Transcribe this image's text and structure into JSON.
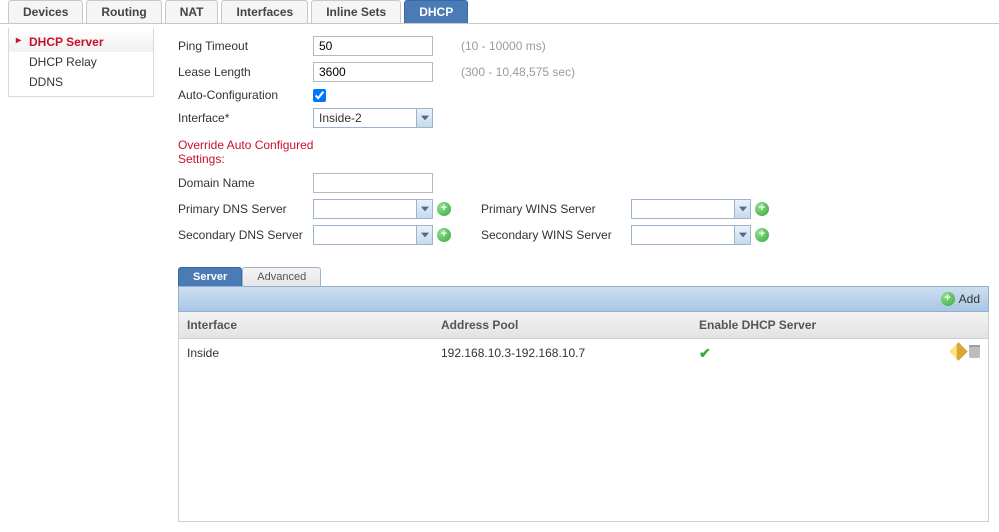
{
  "topTabs": {
    "devices": "Devices",
    "routing": "Routing",
    "nat": "NAT",
    "interfaces": "Interfaces",
    "inlineSets": "Inline Sets",
    "dhcp": "DHCP",
    "active": "dhcp"
  },
  "sidebar": {
    "items": [
      {
        "id": "dhcp-server",
        "label": "DHCP Server",
        "active": true
      },
      {
        "id": "dhcp-relay",
        "label": "DHCP Relay",
        "active": false
      },
      {
        "id": "ddns",
        "label": "DDNS",
        "active": false
      }
    ]
  },
  "form": {
    "pingTimeout": {
      "label": "Ping Timeout",
      "value": "50",
      "hint": "(10 - 10000 ms)"
    },
    "leaseLength": {
      "label": "Lease Length",
      "value": "3600",
      "hint": "(300 - 10,48,575 sec)"
    },
    "autoConfig": {
      "label": "Auto-Configuration",
      "checked": true
    },
    "interface": {
      "label": "Interface*",
      "value": "Inside-2"
    },
    "overrideHeading": "Override Auto Configured Settings:",
    "domainName": {
      "label": "Domain Name",
      "value": ""
    },
    "primaryDns": {
      "label": "Primary DNS Server",
      "value": ""
    },
    "secondaryDns": {
      "label": "Secondary DNS Server",
      "value": ""
    },
    "primaryWins": {
      "label": "Primary WINS Server",
      "value": ""
    },
    "secondaryWins": {
      "label": "Secondary WINS Server",
      "value": ""
    }
  },
  "subTabs": {
    "server": "Server",
    "advanced": "Advanced",
    "active": "server"
  },
  "toolbar": {
    "addLabel": "Add"
  },
  "table": {
    "headers": {
      "interface": "Interface",
      "pool": "Address Pool",
      "enable": "Enable DHCP Server"
    },
    "rows": [
      {
        "interface": "Inside",
        "pool": "192.168.10.3-192.168.10.7",
        "enabled": true
      }
    ]
  }
}
